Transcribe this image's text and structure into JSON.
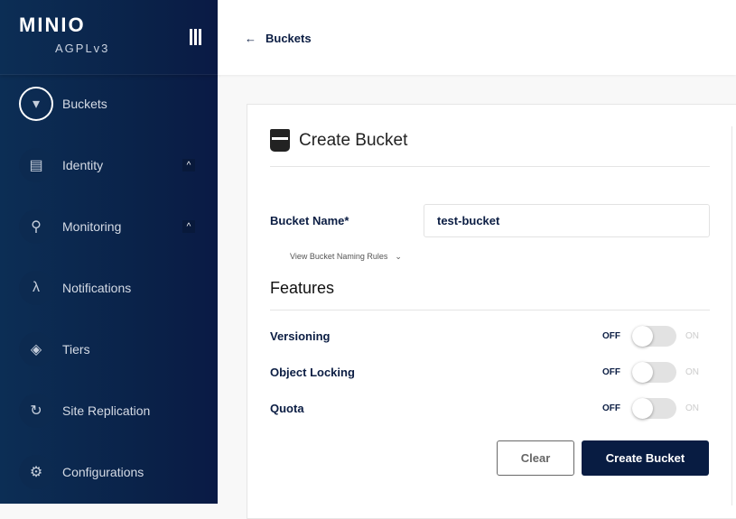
{
  "brand": {
    "logo": "MINIO",
    "license": "AGPLv3"
  },
  "sidebar": {
    "items": [
      {
        "label": "Buckets",
        "icon": "bucket-icon",
        "active": true
      },
      {
        "label": "Identity",
        "icon": "id-card-icon",
        "expandable": true
      },
      {
        "label": "Monitoring",
        "icon": "monitoring-icon",
        "expandable": true
      },
      {
        "label": "Notifications",
        "icon": "lambda-icon"
      },
      {
        "label": "Tiers",
        "icon": "layers-icon"
      },
      {
        "label": "Site Replication",
        "icon": "replication-icon"
      },
      {
        "label": "Configurations",
        "icon": "gear-icon"
      }
    ]
  },
  "topbar": {
    "back_label": "Buckets",
    "back_arrow": "←"
  },
  "form": {
    "title": "Create Bucket",
    "bucket_name_label": "Bucket Name*",
    "bucket_name_value": "test-bucket",
    "naming_rules": "View Bucket Naming Rules",
    "features_title": "Features",
    "features": [
      {
        "label": "Versioning",
        "off": "OFF",
        "on": "ON",
        "enabled": false
      },
      {
        "label": "Object Locking",
        "off": "OFF",
        "on": "ON",
        "enabled": false
      },
      {
        "label": "Quota",
        "off": "OFF",
        "on": "ON",
        "enabled": false
      }
    ],
    "clear_label": "Clear",
    "create_label": "Create Bucket"
  },
  "colors": {
    "primary": "#081c42",
    "sidebar": "#0c2e55"
  }
}
